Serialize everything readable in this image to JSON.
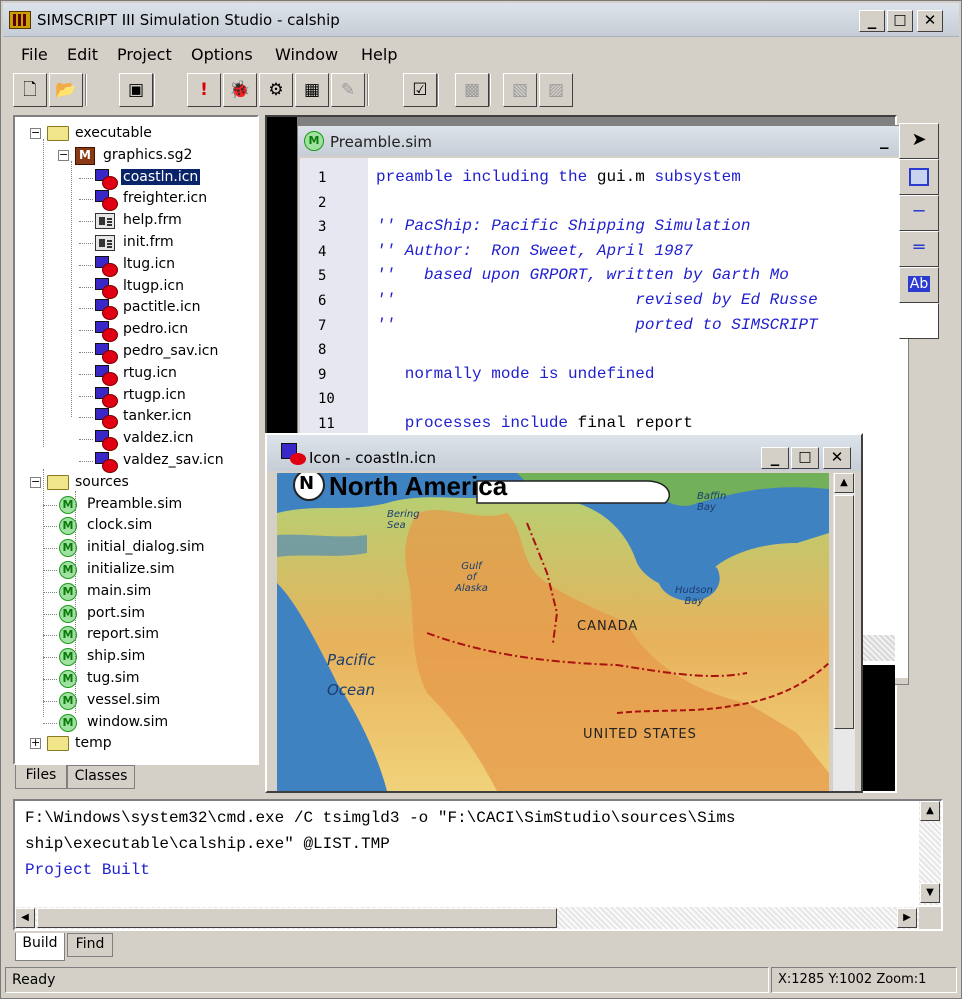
{
  "window": {
    "title": "SIMSCRIPT III Simulation Studio - calship",
    "minimize": "_",
    "maximize": "□",
    "close": "✕"
  },
  "menu": [
    "File",
    "Edit",
    "Project",
    "Options",
    "Window",
    "Help"
  ],
  "toolbar": [
    {
      "icon": "new-file-icon",
      "glyph": "🗋",
      "enabled": true
    },
    {
      "icon": "open-folder-icon",
      "glyph": "📂",
      "enabled": true
    },
    {
      "icon": "build-icon",
      "glyph": "▣",
      "enabled": true
    },
    {
      "icon": "run-exclamation-icon",
      "glyph": "!",
      "enabled": true
    },
    {
      "icon": "debug-bug-icon",
      "glyph": "🐞",
      "enabled": true
    },
    {
      "icon": "compile-icon",
      "glyph": "⚙",
      "enabled": true
    },
    {
      "icon": "link-icon",
      "glyph": "▦",
      "enabled": true
    },
    {
      "icon": "edit-disabled-icon",
      "glyph": "✎",
      "enabled": false
    },
    {
      "icon": "properties-icon",
      "glyph": "☑",
      "enabled": true
    },
    {
      "icon": "grid-disabled-icon",
      "glyph": "▩",
      "enabled": false
    },
    {
      "icon": "graphic-disabled-icon",
      "glyph": "▧",
      "enabled": false
    },
    {
      "icon": "graphic2-disabled-icon",
      "glyph": "▨",
      "enabled": false
    }
  ],
  "tree": [
    {
      "label": "executable",
      "type": "folder",
      "depth": 0,
      "exp": "−"
    },
    {
      "label": "graphics.sg2",
      "type": "sg",
      "depth": 1,
      "exp": "−"
    },
    {
      "label": "coastln.icn",
      "type": "icn",
      "depth": 2,
      "selected": true
    },
    {
      "label": "freighter.icn",
      "type": "icn",
      "depth": 2
    },
    {
      "label": "help.frm",
      "type": "frm",
      "depth": 2
    },
    {
      "label": "init.frm",
      "type": "frm",
      "depth": 2
    },
    {
      "label": "ltug.icn",
      "type": "icn",
      "depth": 2
    },
    {
      "label": "ltugp.icn",
      "type": "icn",
      "depth": 2
    },
    {
      "label": "pactitle.icn",
      "type": "icn",
      "depth": 2
    },
    {
      "label": "pedro.icn",
      "type": "icn",
      "depth": 2
    },
    {
      "label": "pedro_sav.icn",
      "type": "icn",
      "depth": 2
    },
    {
      "label": "rtug.icn",
      "type": "icn",
      "depth": 2
    },
    {
      "label": "rtugp.icn",
      "type": "icn",
      "depth": 2
    },
    {
      "label": "tanker.icn",
      "type": "icn",
      "depth": 2
    },
    {
      "label": "valdez.icn",
      "type": "icn",
      "depth": 2
    },
    {
      "label": "valdez_sav.icn",
      "type": "icn",
      "depth": 2
    },
    {
      "label": "sources",
      "type": "folder",
      "depth": 0,
      "exp": "−"
    },
    {
      "label": "Preamble.sim",
      "type": "sim",
      "depth": 1
    },
    {
      "label": "clock.sim",
      "type": "sim",
      "depth": 1
    },
    {
      "label": "initial_dialog.sim",
      "type": "sim",
      "depth": 1
    },
    {
      "label": "initialize.sim",
      "type": "sim",
      "depth": 1
    },
    {
      "label": "main.sim",
      "type": "sim",
      "depth": 1
    },
    {
      "label": "port.sim",
      "type": "sim",
      "depth": 1
    },
    {
      "label": "report.sim",
      "type": "sim",
      "depth": 1
    },
    {
      "label": "ship.sim",
      "type": "sim",
      "depth": 1
    },
    {
      "label": "tug.sim",
      "type": "sim",
      "depth": 1
    },
    {
      "label": "vessel.sim",
      "type": "sim",
      "depth": 1
    },
    {
      "label": "window.sim",
      "type": "sim",
      "depth": 1
    },
    {
      "label": "temp",
      "type": "folder",
      "depth": 0,
      "exp": "+"
    }
  ],
  "left_tabs": {
    "files": "Files",
    "classes": "Classes"
  },
  "editor": {
    "title": "Preamble.sim",
    "badge": "M",
    "lines": [
      {
        "n": "1",
        "parts": [
          {
            "t": "preamble including the ",
            "c": "kw"
          },
          {
            "t": "gui.m",
            "c": "tx"
          },
          {
            "t": " subsystem",
            "c": "kw"
          }
        ]
      },
      {
        "n": "2",
        "parts": []
      },
      {
        "n": "3",
        "parts": [
          {
            "t": "'' PacShip: Pacific Shipping Simulation",
            "c": "cm"
          }
        ]
      },
      {
        "n": "4",
        "parts": [
          {
            "t": "'' Author:  Ron Sweet, April 1987",
            "c": "cm"
          }
        ]
      },
      {
        "n": "5",
        "parts": [
          {
            "t": "''   based upon GRPORT, written by Garth Mo",
            "c": "cm"
          }
        ]
      },
      {
        "n": "6",
        "parts": [
          {
            "t": "''                         revised by Ed Russe",
            "c": "cm"
          }
        ]
      },
      {
        "n": "7",
        "parts": [
          {
            "t": "''                         ported to SIMSCRIPT",
            "c": "cm"
          }
        ]
      },
      {
        "n": "8",
        "parts": []
      },
      {
        "n": "9",
        "parts": [
          {
            "t": "   normally mode is undefined",
            "c": "kw"
          }
        ]
      },
      {
        "n": "10",
        "parts": []
      },
      {
        "n": "11",
        "parts": [
          {
            "t": "   processes include ",
            "c": "kw"
          },
          {
            "t": "final report",
            "c": "tx"
          }
        ]
      }
    ]
  },
  "right_toolbar": [
    {
      "icon": "pointer-arrow-icon",
      "glyph": "➤"
    },
    {
      "icon": "rectangle-tool-icon",
      "glyph": "□"
    },
    {
      "icon": "line-tool-icon",
      "glyph": "─"
    },
    {
      "icon": "double-line-tool-icon",
      "glyph": "═"
    },
    {
      "icon": "text-tool-icon",
      "glyph": "Ab"
    },
    {
      "icon": "blank-tool-icon",
      "glyph": ""
    }
  ],
  "icon_window": {
    "title": "Icon - coastln.icn",
    "map_badge": "N",
    "map_title": "North America",
    "labels": {
      "bering": "Bering\nSea",
      "gulf": "Gulf\nof\nAlaska",
      "hudson": "Hudson\nBay",
      "baffin": "Baffin\nBay",
      "canada": "CANADA",
      "pacific": "Pacific",
      "ocean": "Ocean",
      "us": "UNITED STATES"
    }
  },
  "output": {
    "lines": [
      {
        "text": "F:\\Windows\\system32\\cmd.exe /C tsimgld3 -o \"F:\\CACI\\SimStudio\\sources\\Sims",
        "color": "#000000"
      },
      {
        "text": "ship\\executable\\calship.exe\" @LIST.TMP",
        "color": "#000000"
      },
      {
        "text": "Project Built",
        "color": "#1f1fcf"
      }
    ]
  },
  "bottom_tabs": {
    "build": "Build",
    "find": "Find"
  },
  "status": {
    "left": "Ready",
    "right": "X:1285 Y:1002 Zoom:1"
  }
}
